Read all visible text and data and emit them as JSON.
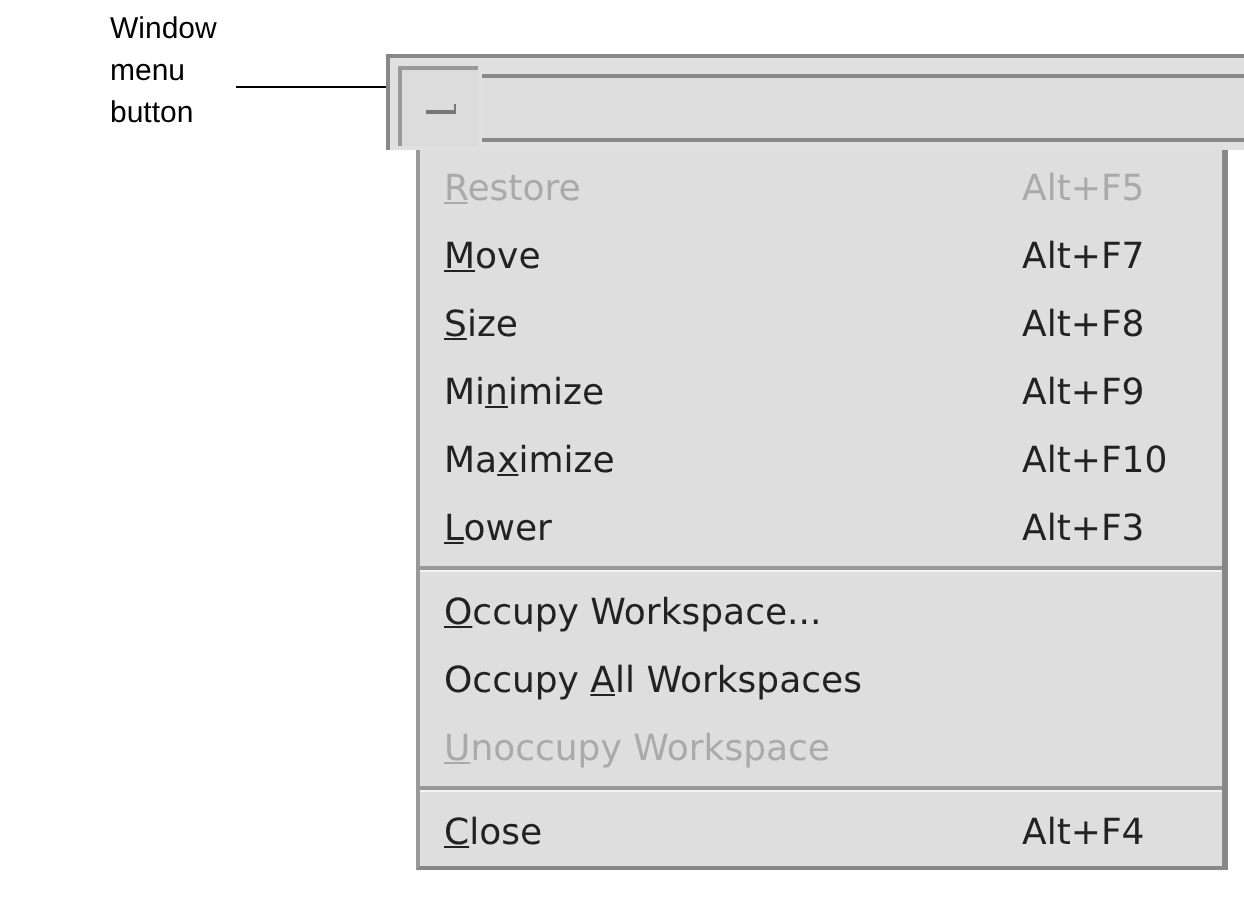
{
  "callout": {
    "label": "Window menu button"
  },
  "menu": {
    "items": [
      {
        "kind": "item",
        "mnemonic": "R",
        "label_after": "estore",
        "shortcut": "Alt+F5",
        "disabled": true
      },
      {
        "kind": "item",
        "mnemonic": "M",
        "label_after": "ove",
        "shortcut": "Alt+F7",
        "disabled": false
      },
      {
        "kind": "item",
        "mnemonic": "S",
        "label_after": "ize",
        "shortcut": "Alt+F8",
        "disabled": false
      },
      {
        "kind": "item",
        "label_before": "Mi",
        "mnemonic": "n",
        "label_after": "imize",
        "shortcut": "Alt+F9",
        "disabled": false
      },
      {
        "kind": "item",
        "label_before": "Ma",
        "mnemonic": "x",
        "label_after": "imize",
        "shortcut": "Alt+F10",
        "disabled": false
      },
      {
        "kind": "item",
        "mnemonic": "L",
        "label_after": "ower",
        "shortcut": "Alt+F3",
        "disabled": false
      },
      {
        "kind": "separator"
      },
      {
        "kind": "item",
        "mnemonic": "O",
        "label_after": "ccupy Workspace...",
        "disabled": false
      },
      {
        "kind": "item",
        "label_before": "Occupy ",
        "mnemonic": "A",
        "label_after": "ll Workspaces",
        "disabled": false
      },
      {
        "kind": "item",
        "mnemonic": "U",
        "label_after": "noccupy Workspace",
        "disabled": true
      },
      {
        "kind": "separator"
      },
      {
        "kind": "item",
        "mnemonic": "C",
        "label_after": "lose",
        "shortcut": "Alt+F4",
        "disabled": false
      }
    ]
  }
}
